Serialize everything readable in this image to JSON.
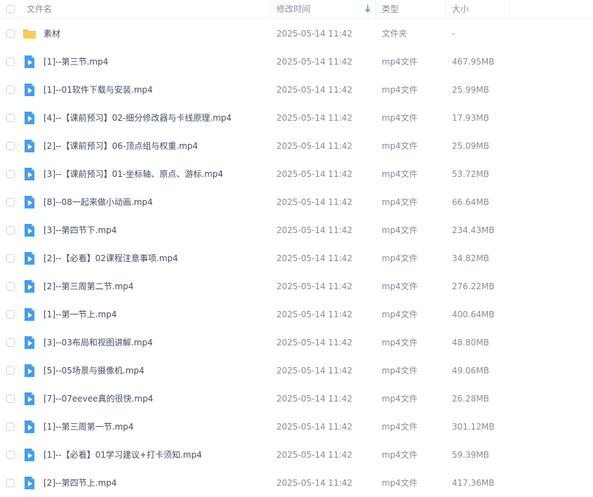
{
  "header": {
    "name": "文件名",
    "modified": "修改时间",
    "type": "类型",
    "size": "大小"
  },
  "rows": [
    {
      "name": "素材",
      "time": "2025-05-14 11:42",
      "type": "文件夹",
      "size": "-",
      "icon": "folder-icon"
    },
    {
      "name": "[1]--第三节.mp4",
      "time": "2025-05-14 11:42",
      "type": "mp4文件",
      "size": "467.95MB",
      "icon": "video-file-icon"
    },
    {
      "name": "[1]--01软件下载与安装.mp4",
      "time": "2025-05-14 11:42",
      "type": "mp4文件",
      "size": "25.99MB",
      "icon": "video-file-icon"
    },
    {
      "name": "[4]--【课前预习】02-细分修改器与卡线原理.mp4",
      "time": "2025-05-14 11:42",
      "type": "mp4文件",
      "size": "17.93MB",
      "icon": "video-file-icon"
    },
    {
      "name": "[2]--【课前预习】06-顶点组与权重.mp4",
      "time": "2025-05-14 11:42",
      "type": "mp4文件",
      "size": "25.09MB",
      "icon": "video-file-icon"
    },
    {
      "name": "[3]--【课前预习】01-坐标轴、原点、游标.mp4",
      "time": "2025-05-14 11:42",
      "type": "mp4文件",
      "size": "53.72MB",
      "icon": "video-file-icon"
    },
    {
      "name": "[8]--08一起来做小动画.mp4",
      "time": "2025-05-14 11:42",
      "type": "mp4文件",
      "size": "66.64MB",
      "icon": "video-file-icon"
    },
    {
      "name": "[3]--第四节下.mp4",
      "time": "2025-05-14 11:42",
      "type": "mp4文件",
      "size": "234.43MB",
      "icon": "video-file-icon"
    },
    {
      "name": "[2]--【必看】02课程注意事项.mp4",
      "time": "2025-05-14 11:42",
      "type": "mp4文件",
      "size": "34.82MB",
      "icon": "video-file-icon"
    },
    {
      "name": "[2]--第三周第二节.mp4",
      "time": "2025-05-14 11:42",
      "type": "mp4文件",
      "size": "276.22MB",
      "icon": "video-file-icon"
    },
    {
      "name": "[1]--第一节上.mp4",
      "time": "2025-05-14 11:42",
      "type": "mp4文件",
      "size": "400.64MB",
      "icon": "video-file-icon"
    },
    {
      "name": "[3]--03布局和视图讲解.mp4",
      "time": "2025-05-14 11:42",
      "type": "mp4文件",
      "size": "48.80MB",
      "icon": "video-file-icon"
    },
    {
      "name": "[5]--05场景与摄像机.mp4",
      "time": "2025-05-14 11:42",
      "type": "mp4文件",
      "size": "49.06MB",
      "icon": "video-file-icon"
    },
    {
      "name": "[7]--07eevee真的很快.mp4",
      "time": "2025-05-14 11:42",
      "type": "mp4文件",
      "size": "26.28MB",
      "icon": "video-file-icon"
    },
    {
      "name": "[1]--第三周第一节.mp4",
      "time": "2025-05-14 11:42",
      "type": "mp4文件",
      "size": "301.12MB",
      "icon": "video-file-icon"
    },
    {
      "name": "[1]--【必看】01学习建议+打卡须知.mp4",
      "time": "2025-05-14 11:42",
      "type": "mp4文件",
      "size": "59.39MB",
      "icon": "video-file-icon"
    },
    {
      "name": "[2]--第四节上.mp4",
      "time": "2025-05-14 11:42",
      "type": "mp4文件",
      "size": "417.36MB",
      "icon": "video-file-icon"
    }
  ],
  "colors": {
    "folder": "#f5c143",
    "video": "#3f9ef5",
    "sort_arrow": "#3f9ef5"
  }
}
